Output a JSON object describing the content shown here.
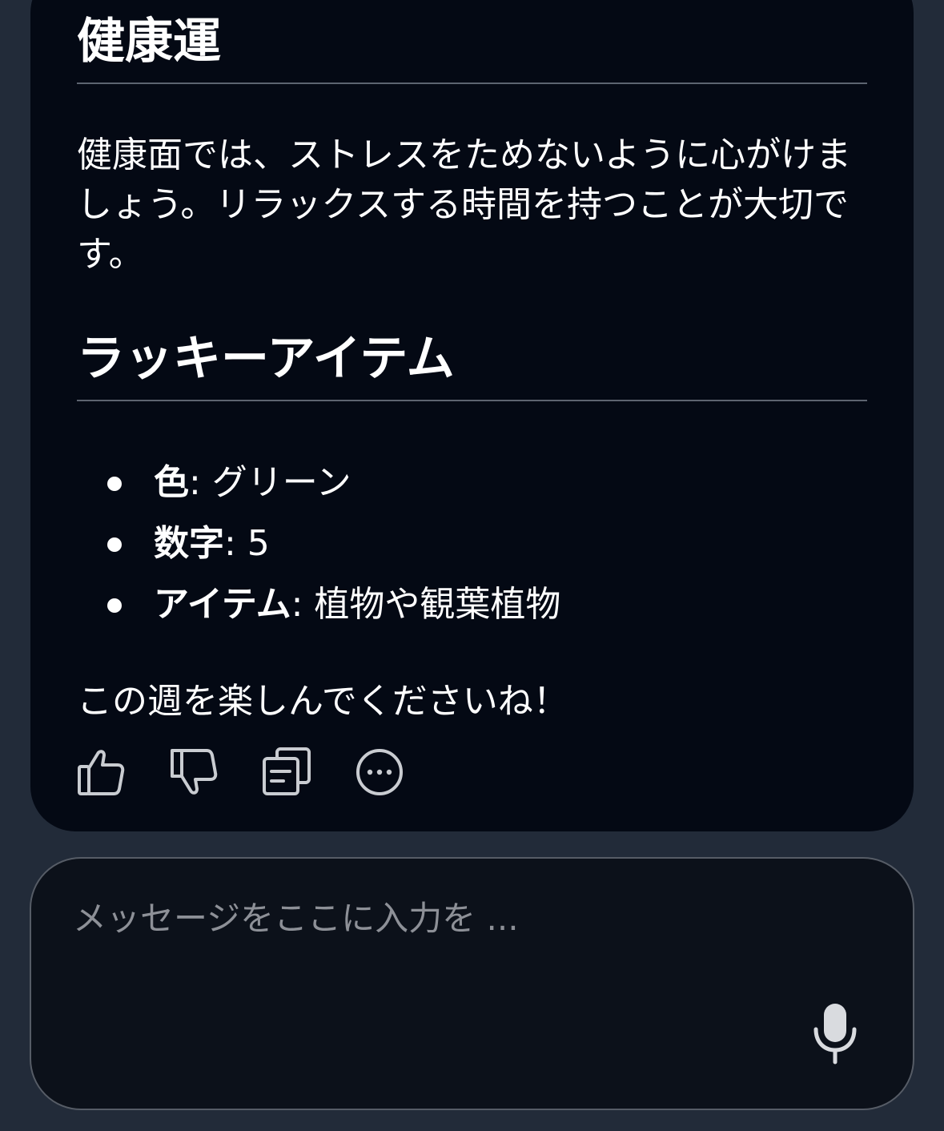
{
  "message": {
    "health_heading": "健康運",
    "health_text": "健康面では、ストレスをためないように心がけましょう。リラックスする時間を持つことが大切です。",
    "lucky_heading": "ラッキーアイテム",
    "lucky_items": [
      {
        "key": "色",
        "value": ": グリーン"
      },
      {
        "key": "数字",
        "value": ": 5"
      },
      {
        "key": "アイテム",
        "value": ": 植物や観葉植物"
      }
    ],
    "closing_text": "この週を楽しんでくださいね！"
  },
  "actions": {
    "icons": [
      "thumbs-up-icon",
      "thumbs-down-icon",
      "copy-icon",
      "more-options-icon"
    ]
  },
  "composer": {
    "placeholder": "メッセージをここに入力を ...",
    "value": "",
    "mic_icon": "microphone-icon"
  },
  "colors": {
    "page_background": "#222b39",
    "card_background": "#040914",
    "composer_background": "#0c111a",
    "text": "#ffffff",
    "placeholder": "#8d9097"
  }
}
